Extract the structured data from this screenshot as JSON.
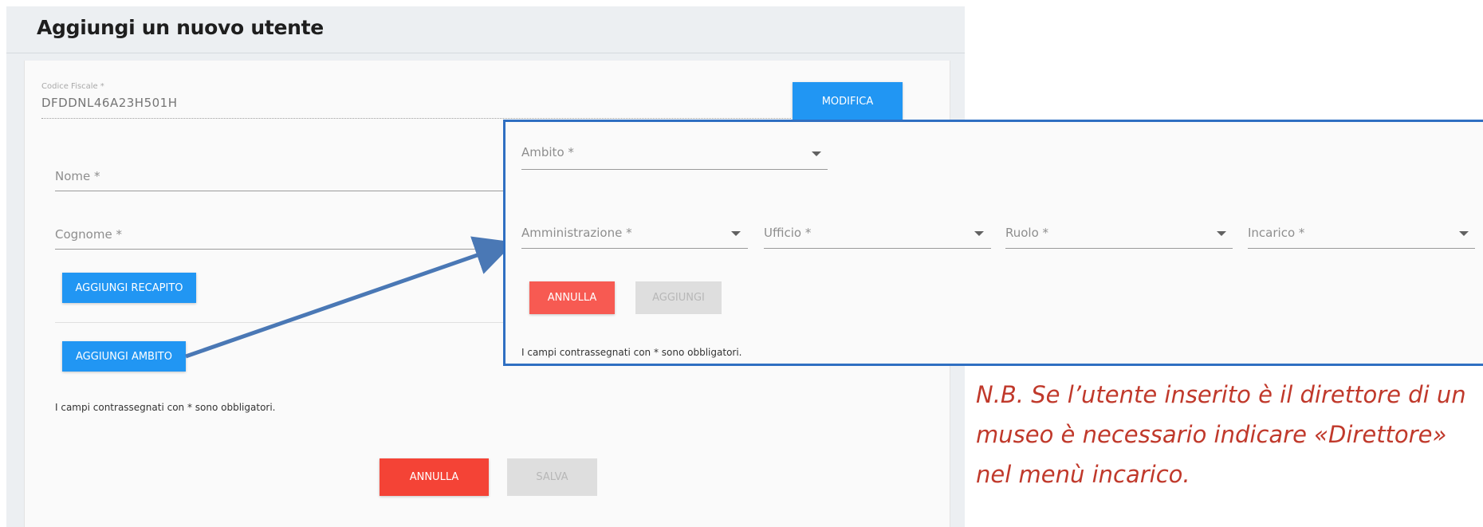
{
  "page": {
    "title": "Aggiungi un nuovo utente"
  },
  "form": {
    "codice_fiscale": {
      "label": "Codice Fiscale *",
      "value": "DFDDNL46A23H501H"
    },
    "modifica_button": "MODIFICA",
    "nome_placeholder": "Nome *",
    "cognome_placeholder": "Cognome *",
    "aggiungi_recapito_button": "AGGIUNGI RECAPITO",
    "aggiungi_ambito_button": "AGGIUNGI AMBITO",
    "required_note": "I campi contrassegnati con * sono obbligatori.",
    "annulla_button": "ANNULLA",
    "salva_button": "SALVA"
  },
  "ambito_popup": {
    "ambito_select": "Ambito *",
    "amministrazione_select": "Amministrazione *",
    "ufficio_select": "Ufficio *",
    "ruolo_select": "Ruolo *",
    "incarico_select": "Incarico *",
    "annulla_button": "ANNULLA",
    "aggiungi_button": "AGGIUNGI",
    "required_note": "I campi contrassegnati con * sono obbligatori."
  },
  "annotation": {
    "note": "N.B. Se l’utente inserito è il direttore di un museo è necessario indicare «Direttore» nel menù incarico.",
    "highlight_color": "#2f6fc2",
    "note_color": "#c0392b"
  },
  "colors": {
    "primary": "#2196f3",
    "danger": "#f44336",
    "disabled": "#dedede"
  }
}
